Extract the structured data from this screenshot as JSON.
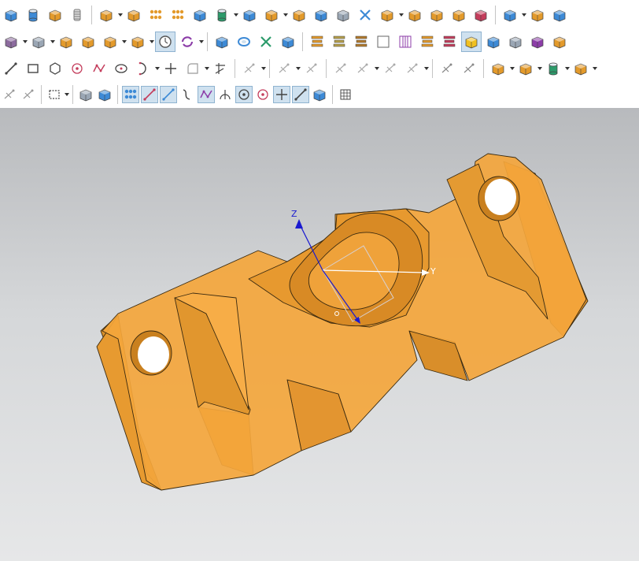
{
  "toolbar": {
    "rows": [
      {
        "id": "row1",
        "items": [
          {
            "name": "block-icon",
            "kind": "box",
            "color": "#3d8ad6"
          },
          {
            "name": "cylinder-icon",
            "kind": "cyl",
            "color": "#3d8ad6"
          },
          {
            "name": "pad-icon",
            "kind": "box",
            "color": "#e39a2b"
          },
          {
            "name": "coil-icon",
            "kind": "coil",
            "color": "#7a7a7a"
          },
          {
            "sep": true
          },
          {
            "name": "extrude-icon",
            "kind": "box",
            "color": "#e39a2b",
            "drop": true
          },
          {
            "name": "revolve-icon",
            "kind": "box",
            "color": "#e39a2b"
          },
          {
            "name": "pattern-icon",
            "kind": "dots",
            "color": "#e39a2b"
          },
          {
            "name": "array-icon",
            "kind": "dots",
            "color": "#e39a2b"
          },
          {
            "name": "feature-move-icon",
            "kind": "box",
            "color": "#3d8ad6"
          },
          {
            "name": "boolean-icon",
            "kind": "cyl",
            "color": "#2c9b6b",
            "drop": true
          },
          {
            "name": "chamfer-icon",
            "kind": "box",
            "color": "#3d8ad6"
          },
          {
            "name": "shell-icon",
            "kind": "box",
            "color": "#e39a2b",
            "drop": true
          },
          {
            "name": "draft-icon",
            "kind": "box",
            "color": "#e39a2b"
          },
          {
            "name": "sweep-icon",
            "kind": "box",
            "color": "#3d8ad6"
          },
          {
            "name": "offset-face-icon",
            "kind": "box",
            "color": "#9aa6b4"
          },
          {
            "name": "trim-body-icon",
            "kind": "x",
            "color": "#3d8ad6"
          },
          {
            "name": "split-body-icon",
            "kind": "box",
            "color": "#e39a2b",
            "drop": true
          },
          {
            "name": "mirror-body-icon",
            "kind": "box",
            "color": "#e39a2b"
          },
          {
            "name": "face-blend-icon",
            "kind": "box",
            "color": "#e39a2b"
          },
          {
            "name": "extract-icon",
            "kind": "box",
            "color": "#e39a2b"
          },
          {
            "name": "scale-body-icon",
            "kind": "box",
            "color": "#c43d5c"
          },
          {
            "sep": true
          },
          {
            "name": "edge-blend-icon",
            "kind": "box",
            "color": "#3d8ad6",
            "drop": true
          },
          {
            "name": "thicken-icon",
            "kind": "box",
            "color": "#e39a2b"
          },
          {
            "name": "body-icon",
            "kind": "box",
            "color": "#3d8ad6"
          }
        ]
      },
      {
        "id": "row2",
        "items": [
          {
            "name": "solid-icon",
            "kind": "box",
            "color": "#8c6b9e",
            "drop": true
          },
          {
            "name": "hole-icon",
            "kind": "box",
            "color": "#9aa6b4",
            "drop": true
          },
          {
            "name": "boss-icon",
            "kind": "box",
            "color": "#e39a2b"
          },
          {
            "name": "pocket-icon",
            "kind": "box",
            "color": "#e39a2b"
          },
          {
            "name": "slot-icon",
            "kind": "box",
            "color": "#e39a2b",
            "drop": true
          },
          {
            "name": "groove-icon",
            "kind": "box",
            "color": "#e39a2b",
            "drop": true
          },
          {
            "name": "clock-icon",
            "kind": "clock",
            "color": "#555555",
            "active": true
          },
          {
            "name": "update-icon",
            "kind": "refresh",
            "color": "#8c3da8",
            "drop": true
          },
          {
            "sep": true
          },
          {
            "name": "sketch-box-icon",
            "kind": "box",
            "color": "#3d8ad6"
          },
          {
            "name": "section-icon",
            "kind": "ring",
            "color": "#3d8ad6"
          },
          {
            "name": "measure-icon",
            "kind": "x",
            "color": "#2c9b6b"
          },
          {
            "name": "layer-icon",
            "kind": "box",
            "color": "#3d8ad6"
          },
          {
            "sep": true
          },
          {
            "name": "plate-stack-icon",
            "kind": "stack",
            "color": "#e39a2b"
          },
          {
            "name": "tower-icon",
            "kind": "stack",
            "color": "#b7a04a"
          },
          {
            "name": "scaffold-icon",
            "kind": "stack",
            "color": "#b37a2b"
          },
          {
            "name": "blank-square-icon",
            "kind": "blank",
            "color": "#666666"
          },
          {
            "name": "columns-icon",
            "kind": "columns",
            "color": "#8c3da8"
          },
          {
            "name": "layers-icon",
            "kind": "stack",
            "color": "#e39a2b"
          },
          {
            "name": "wave-stack-icon",
            "kind": "stack",
            "color": "#c43d5c"
          },
          {
            "name": "shaded-cube-icon",
            "kind": "box",
            "color": "#f0c020",
            "active": true
          },
          {
            "name": "component-icon",
            "kind": "box",
            "color": "#3d8ad6"
          },
          {
            "name": "drawing-sheet-icon",
            "kind": "box",
            "color": "#9aa6b4"
          },
          {
            "name": "door-icon",
            "kind": "box",
            "color": "#8c3da8"
          },
          {
            "name": "cube-end-icon",
            "kind": "box",
            "color": "#e39a2b"
          }
        ]
      },
      {
        "id": "row3",
        "items": [
          {
            "name": "line-icon",
            "kind": "line",
            "color": "#444444"
          },
          {
            "name": "rectangle-icon",
            "kind": "rect",
            "color": "#444444"
          },
          {
            "name": "polygon-icon",
            "kind": "hex",
            "color": "#444444"
          },
          {
            "name": "point-icon",
            "kind": "circdot",
            "color": "#c43d5c"
          },
          {
            "name": "spline-icon",
            "kind": "zigzag",
            "color": "#c43d5c"
          },
          {
            "name": "ellipse-icon",
            "kind": "ellipse",
            "color": "#444444"
          },
          {
            "name": "arc-icon",
            "kind": "arc",
            "color": "#444444",
            "drop": true
          },
          {
            "name": "cross-point-icon",
            "kind": "plus",
            "color": "#444444"
          },
          {
            "name": "fillet-sketch-icon",
            "kind": "fillet",
            "color": "#9a9a9a",
            "drop": true
          },
          {
            "name": "trim-sketch-icon",
            "kind": "trim",
            "color": "#444444"
          },
          {
            "sep": true
          },
          {
            "name": "offset-curve-icon",
            "kind": "faint",
            "color": "#aaaaaa",
            "drop": true
          },
          {
            "sep": true
          },
          {
            "name": "mirror-curve-icon",
            "kind": "faint",
            "color": "#aaaaaa",
            "drop": true
          },
          {
            "name": "project-curve-icon",
            "kind": "faint",
            "color": "#aaaaaa"
          },
          {
            "sep": true
          },
          {
            "name": "parallel-constraint-icon",
            "kind": "faint",
            "color": "#aaaaaa"
          },
          {
            "name": "tangent-constraint-icon",
            "kind": "faint",
            "color": "#aaaaaa",
            "drop": true
          },
          {
            "name": "dimension-icon",
            "kind": "faint",
            "color": "#aaaaaa"
          },
          {
            "name": "perpendicular-constraint-icon",
            "kind": "faint",
            "color": "#aaaaaa",
            "drop": true
          },
          {
            "sep": true
          },
          {
            "name": "convert-reference-icon",
            "kind": "faint",
            "color": "#888888"
          },
          {
            "name": "alternate-solution-icon",
            "kind": "faint",
            "color": "#888888"
          },
          {
            "sep": true
          },
          {
            "name": "extrude-feature-icon",
            "kind": "box",
            "color": "#e39a2b",
            "drop": true
          },
          {
            "name": "revolve-feature-icon",
            "kind": "box",
            "color": "#e39a2b",
            "drop": true
          },
          {
            "name": "unite-feature-icon",
            "kind": "cyl",
            "color": "#2c9b6b",
            "drop": true
          },
          {
            "name": "hole-feature-icon",
            "kind": "box",
            "color": "#e39a2b",
            "drop": true
          }
        ]
      },
      {
        "id": "row4",
        "items": [
          {
            "name": "snap-point-icon",
            "kind": "faint",
            "color": "#999999"
          },
          {
            "name": "snap-select-icon",
            "kind": "faint",
            "color": "#999999"
          },
          {
            "sep": true
          },
          {
            "name": "select-rectangle-icon",
            "kind": "dashrect",
            "color": "#444444",
            "drop": true
          },
          {
            "sep": true
          },
          {
            "name": "select-face-icon",
            "kind": "box",
            "color": "#9aa6b4"
          },
          {
            "name": "select-body-icon",
            "kind": "box",
            "color": "#3d8ad6"
          },
          {
            "sep": true
          },
          {
            "name": "snap-grid-icon",
            "kind": "dots",
            "color": "#3d8ad6",
            "active": true
          },
          {
            "name": "snap-endpoint-icon",
            "kind": "line",
            "color": "#c43d5c",
            "active": true
          },
          {
            "name": "snap-midpoint-icon",
            "kind": "line",
            "color": "#3d8ad6",
            "active": true
          },
          {
            "name": "snap-curve-icon",
            "kind": "curve",
            "color": "#444444"
          },
          {
            "name": "snap-control-icon",
            "kind": "zigzag",
            "color": "#8c3da8",
            "active": true
          },
          {
            "name": "snap-intersection-icon",
            "kind": "arcs",
            "color": "#444444"
          },
          {
            "name": "snap-center-icon",
            "kind": "circdot",
            "color": "#444444",
            "active": true
          },
          {
            "name": "snap-quadrant-icon",
            "kind": "circdot",
            "color": "#c43d5c"
          },
          {
            "name": "snap-on-curve-icon",
            "kind": "plus",
            "color": "#444444",
            "active": true
          },
          {
            "name": "snap-on-face-icon",
            "kind": "line",
            "color": "#444444",
            "active": true
          },
          {
            "name": "snap-bounded-icon",
            "kind": "box",
            "color": "#3d8ad6"
          },
          {
            "sep": true
          },
          {
            "name": "grid-options-icon",
            "kind": "grid",
            "color": "#444444"
          }
        ]
      }
    ]
  },
  "viewport": {
    "background_top": "#b8babd",
    "background_bottom": "#e6e7e8",
    "part_color": "#f2a33a",
    "edge_color": "#3a2a10",
    "triad": {
      "z_label": "Z",
      "y_label": "Y",
      "z_color": "#1a1ad0",
      "y_color": "#ffffff",
      "x_color": "#1a1ad0",
      "frame_color": "#d8d0d0"
    }
  }
}
